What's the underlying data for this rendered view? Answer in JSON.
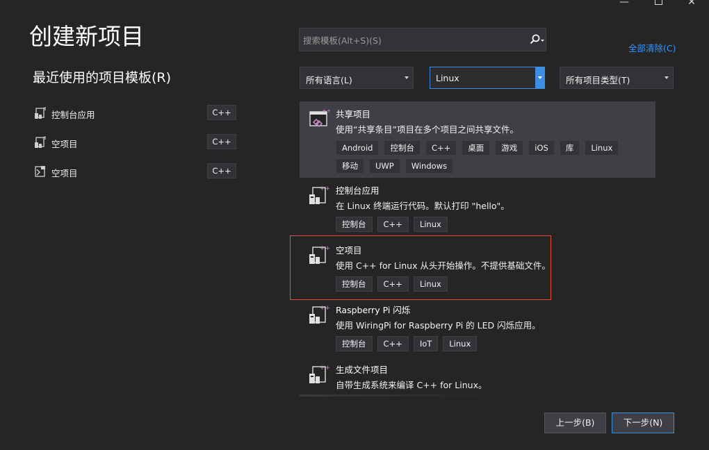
{
  "window": {
    "minimize": "—",
    "close": "✕"
  },
  "header": {
    "title": "创建新项目",
    "recent_title": "最近使用的项目模板(R)"
  },
  "recent": [
    {
      "label": "控制台应用",
      "lang": "C++",
      "icon": "console-app-icon"
    },
    {
      "label": "空项目",
      "lang": "C++",
      "icon": "empty-project-icon"
    },
    {
      "label": "空项目",
      "lang": "C++",
      "icon": "empty-project-windows-icon"
    }
  ],
  "search": {
    "placeholder": "搜索模板(Alt+S)(S)",
    "value": ""
  },
  "clear_all": "全部清除(C)",
  "filters": {
    "language": "所有语言(L)",
    "platform": "Linux",
    "project_type": "所有项目类型(T)"
  },
  "templates": [
    {
      "name": "共享项目",
      "desc": "使用“共享条目”项目在多个项目之间共享文件。",
      "tags": [
        "Android",
        "控制台",
        "C++",
        "桌面",
        "游戏",
        "iOS",
        "库",
        "Linux",
        "移动",
        "UWP",
        "Windows"
      ],
      "icon": "shared-project-icon"
    },
    {
      "name": "控制台应用",
      "desc": "在 Linux 终端运行代码。默认打印 \"hello\"。",
      "tags": [
        "控制台",
        "C++",
        "Linux"
      ],
      "icon": "linux-cpp-icon"
    },
    {
      "name": "空项目",
      "desc": "使用 C++ for Linux 从头开始操作。不提供基础文件。",
      "tags": [
        "控制台",
        "C++",
        "Linux"
      ],
      "icon": "linux-cpp-icon"
    },
    {
      "name": "Raspberry Pi 闪烁",
      "desc": "使用 WiringPi for Raspberry Pi 的 LED 闪烁应用。",
      "tags": [
        "控制台",
        "C++",
        "IoT",
        "Linux"
      ],
      "icon": "linux-cpp-icon"
    },
    {
      "name": "生成文件项目",
      "desc": "自带生成系统来编译 C++ for Linux。",
      "tags": [],
      "icon": "linux-cpp-icon"
    }
  ],
  "footer": {
    "back": "上一步(B)",
    "next": "下一步(N)"
  },
  "colors": {
    "background": "#252526",
    "selected": "#3f3f46",
    "accent": "#3d8ee0",
    "link": "#3794ff",
    "highlight_box": "#e74c3c"
  }
}
